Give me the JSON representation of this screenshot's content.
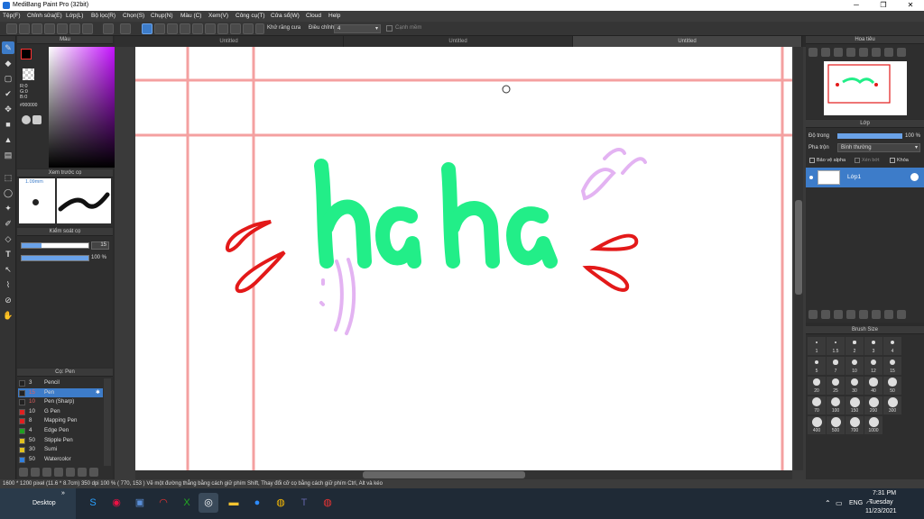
{
  "window": {
    "title": "MediBang Paint Pro (32bit)"
  },
  "menu": [
    "Tệp(F)",
    "Chỉnh sửa(E)",
    "Lớp(L)",
    "Bộ lọc(R)",
    "Chọn(S)",
    "Chụp(N)",
    "Màu (C)",
    "Xem(V)",
    "Công cụ(T)",
    "Cửa sổ(W)",
    "Cloud",
    "Help"
  ],
  "toolbar": {
    "antialias_label": "Khử răng cưa",
    "adjust_label": "Điều chỉnh",
    "adjust_value": "4",
    "edge_label": "Cạnh mềm"
  },
  "panels": {
    "color": {
      "title": "Màu",
      "r": "R:0",
      "g": "G:0",
      "b": "B:0",
      "hex": "#000000"
    },
    "preview": {
      "title": "Xem trước cọ",
      "size": "1.09mm"
    },
    "brush_control": {
      "title": "Kiểm soát cọ",
      "size_value": "15",
      "opacity_value": "100 %"
    },
    "brush_list": {
      "title": "Cọ: Pen"
    },
    "navigator": {
      "title": "Hoa tiêu"
    },
    "layer": {
      "title": "Lớp",
      "opacity_label": "Độ trong",
      "opacity_value": "100 %",
      "blend_label": "Pha trộn",
      "blend_value": "Bình thường",
      "protect_alpha": "Bảo vệ alpha",
      "clipping": "Xén bớt",
      "lock": "Khóa",
      "layer_name": "Lớp1"
    },
    "brush_size": {
      "title": "Brush Size"
    }
  },
  "brushes": [
    {
      "num": "3",
      "name": "Pencil",
      "color": "#222222"
    },
    {
      "num": "15",
      "name": "Pen",
      "color": "#222222",
      "selected": true
    },
    {
      "num": "10",
      "name": "Pen (Sharp)",
      "color": "#222222"
    },
    {
      "num": "10",
      "name": "G Pen",
      "color": "#e02020"
    },
    {
      "num": "8",
      "name": "Mapping Pen",
      "color": "#e02020"
    },
    {
      "num": "4",
      "name": "Edge Pen",
      "color": "#20a020"
    },
    {
      "num": "50",
      "name": "Stipple Pen",
      "color": "#e0c020"
    },
    {
      "num": "30",
      "name": "Sumi",
      "color": "#e0c020"
    },
    {
      "num": "50",
      "name": "Watercolor",
      "color": "#3080e0"
    }
  ],
  "brush_sizes": [
    "1",
    "1.5",
    "2",
    "3",
    "4",
    "5",
    "7",
    "10",
    "12",
    "15",
    "20",
    "25",
    "30",
    "40",
    "50",
    "70",
    "100",
    "150",
    "200",
    "300",
    "400",
    "500",
    "700",
    "1000"
  ],
  "tabs": [
    "Untitled",
    "Untitled",
    "Untitled"
  ],
  "canvas": {
    "text": "haha"
  },
  "status": "1600 * 1200 pixel   (11.6 * 8.7cm)   350 dpi   100 %   ( 770, 153 )  Vẽ một đường thẳng bằng cách giữ phím Shift, Thay đổi cỡ cọ bằng cách giữ phím Ctrl, Alt và kéo",
  "taskbar": {
    "desktop": "Desktop",
    "lang": "ENG",
    "time": "7:31 PM",
    "day": "Tuesday",
    "date": "11/23/2021"
  },
  "colors": {
    "accent": "#3d7cc9",
    "green_text": "#22ee88",
    "red_drops": "#e31919",
    "pink_lines": "#f4a0a0",
    "lilac": "#e3b3f2"
  }
}
